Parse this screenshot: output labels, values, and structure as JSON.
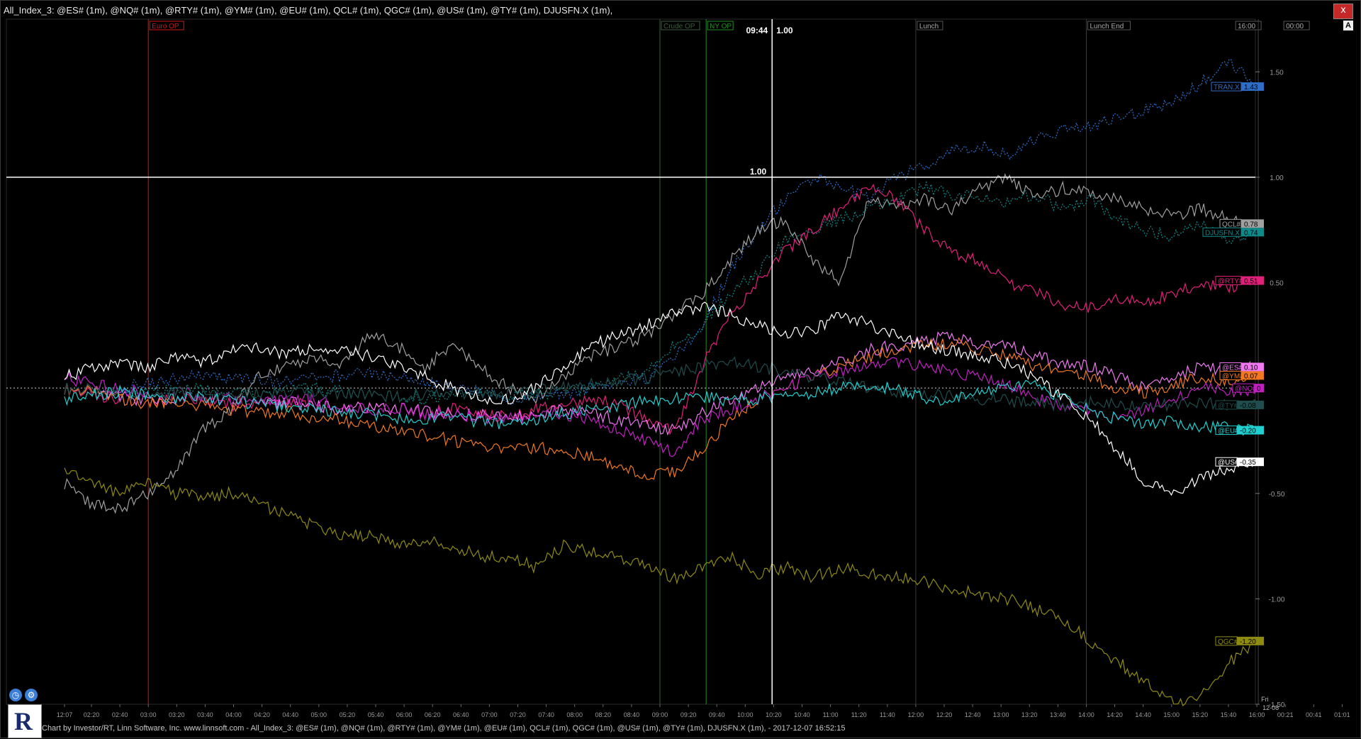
{
  "window": {
    "title": "All_Index_3: @ES# (1m), @NQ# (1m), @RTY# (1m), @YM# (1m), @EU# (1m), QCL# (1m), QGC# (1m), @US# (1m), @TY# (1m), DJUSFN.X (1m),",
    "close_label": "x",
    "auto_scale_label": "A"
  },
  "status_bar": {
    "text": "Chart by Investor/RT, Linn Software, Inc. www.linnsoft.com - All_Index_3: @ES# (1m), @NQ# (1m), @RTY# (1m), @YM# (1m), @EU# (1m), QCL# (1m), QGC# (1m), @US# (1m), @TY# (1m), DJUSFN.X (1m), - 2017-12-07 16:52:15"
  },
  "logo": {
    "letter": "R"
  },
  "icons": {
    "clock": "clock-icon",
    "settings": "gear-icon"
  },
  "colors": {
    "background": "#000000",
    "grid": "#1c1c1c",
    "crosshair": "#ffffff",
    "euro": "#d01818",
    "ny": "#1f8f1f",
    "crude": "#3c5c3c",
    "session": "#3a3a3a"
  },
  "crosshair": {
    "time": "09:44",
    "value": "1.00",
    "horizontal_label": "1.00"
  },
  "session_markers": [
    {
      "label": "Euro OP",
      "time": "03:00",
      "color": "#d01818"
    },
    {
      "label": "Crude OP",
      "time": "09:00",
      "color": "#3c5c3c"
    },
    {
      "label": "NY OP",
      "time": "09:30",
      "color": "#1f8f1f"
    },
    {
      "label": "Lunch",
      "time": "12:00",
      "color": "#3a3a3a"
    },
    {
      "label": "Lunch End",
      "time": "14:00",
      "color": "#3a3a3a"
    },
    {
      "label": "16:00",
      "time": "16:00",
      "color": "#3a3a3a"
    },
    {
      "label": "00:00",
      "time": "00:00",
      "color": "#3a3a3a"
    }
  ],
  "chart_data": {
    "type": "line",
    "title": "",
    "xlabel": "",
    "ylabel": "",
    "ylim": [
      -1.5,
      1.75
    ],
    "y_ticks": [
      "1.50",
      "1.00",
      "0.50",
      "-0.50",
      "-1.00",
      "-1.50"
    ],
    "x_ticks": [
      "12:07",
      "02:20",
      "02:40",
      "03:00",
      "03:20",
      "03:40",
      "04:00",
      "04:20",
      "04:40",
      "05:00",
      "05:20",
      "05:40",
      "06:00",
      "06:20",
      "06:40",
      "07:00",
      "07:20",
      "07:40",
      "08:00",
      "08:20",
      "08:40",
      "09:00",
      "09:20",
      "09:40",
      "10:00",
      "10:20",
      "10:40",
      "11:00",
      "11:20",
      "11:40",
      "12:00",
      "12:20",
      "12:40",
      "13:00",
      "13:20",
      "13:40",
      "14:00",
      "14:20",
      "14:40",
      "15:00",
      "15:20",
      "15:40",
      "16:00",
      "00:21",
      "00:41",
      "01:01"
    ],
    "x_day_label": "Fri",
    "x_day_date": "12-08",
    "grid": true,
    "zero_line": "dotted",
    "series": [
      {
        "name": "TRAN.X",
        "label": "1.43",
        "color": "#2e6ec8",
        "style": "dotted",
        "values": [
          0.05,
          0.02,
          0.0,
          0.02,
          0.04,
          0.06,
          0.05,
          0.04,
          0.03,
          0.05,
          0.06,
          0.08,
          0.05,
          0.03,
          0.0,
          -0.02,
          -0.05,
          -0.04,
          -0.03,
          0.0,
          0.02,
          0.05,
          0.15,
          0.3,
          0.55,
          0.75,
          0.9,
          1.0,
          0.95,
          0.9,
          1.0,
          1.05,
          1.12,
          1.15,
          1.1,
          1.18,
          1.22,
          1.25,
          1.28,
          1.32,
          1.35,
          1.45,
          1.55,
          1.43
        ]
      },
      {
        "name": "QCL#",
        "label": "0.78",
        "color": "#a0a0a0",
        "style": "solid",
        "values": [
          -0.45,
          -0.55,
          -0.58,
          -0.5,
          -0.4,
          -0.2,
          -0.1,
          0.05,
          0.1,
          0.15,
          0.1,
          0.25,
          0.2,
          0.1,
          0.2,
          0.1,
          0.0,
          -0.05,
          0.05,
          0.15,
          0.2,
          0.25,
          0.35,
          0.45,
          0.6,
          0.75,
          0.8,
          0.6,
          0.5,
          0.9,
          0.85,
          0.9,
          0.85,
          0.95,
          1.0,
          0.9,
          0.95,
          0.92,
          0.9,
          0.85,
          0.82,
          0.85,
          0.8,
          0.78
        ]
      },
      {
        "name": "DJUSFN.X",
        "label": "0.74",
        "color": "#0e8a8a",
        "style": "dotted",
        "values": [
          0.0,
          -0.02,
          -0.03,
          -0.02,
          -0.01,
          0.0,
          -0.02,
          -0.03,
          -0.01,
          0.0,
          -0.02,
          -0.03,
          -0.04,
          -0.05,
          -0.03,
          -0.02,
          -0.04,
          -0.03,
          -0.02,
          0.0,
          0.05,
          0.08,
          0.2,
          0.3,
          0.45,
          0.55,
          0.7,
          0.75,
          0.8,
          0.85,
          0.9,
          0.95,
          0.92,
          0.9,
          0.88,
          0.92,
          0.85,
          0.9,
          0.8,
          0.75,
          0.72,
          0.78,
          0.7,
          0.74
        ]
      },
      {
        "name": "@RTY#",
        "label": "0.51",
        "color": "#e0207a",
        "style": "solid",
        "values": [
          0.0,
          -0.03,
          -0.05,
          -0.08,
          -0.05,
          -0.06,
          -0.08,
          -0.07,
          -0.06,
          -0.08,
          -0.1,
          -0.09,
          -0.1,
          -0.12,
          -0.1,
          -0.12,
          -0.14,
          -0.1,
          -0.08,
          -0.05,
          -0.08,
          -0.15,
          -0.2,
          0.1,
          0.35,
          0.5,
          0.65,
          0.75,
          0.85,
          0.95,
          0.9,
          0.75,
          0.65,
          0.6,
          0.5,
          0.45,
          0.4,
          0.38,
          0.42,
          0.4,
          0.45,
          0.5,
          0.48,
          0.51
        ]
      },
      {
        "name": "@ES#",
        "label": "0.10",
        "color": "#f078f0",
        "style": "solid",
        "values": [
          0.0,
          -0.02,
          -0.04,
          -0.06,
          -0.05,
          -0.04,
          -0.06,
          -0.08,
          -0.07,
          -0.08,
          -0.1,
          -0.09,
          -0.1,
          -0.11,
          -0.12,
          -0.13,
          -0.14,
          -0.12,
          -0.1,
          -0.12,
          -0.15,
          -0.18,
          -0.2,
          -0.12,
          -0.05,
          0.0,
          0.05,
          0.08,
          0.12,
          0.18,
          0.2,
          0.22,
          0.25,
          0.2,
          0.22,
          0.15,
          0.12,
          0.1,
          0.05,
          0.0,
          0.05,
          0.1,
          0.08,
          0.1
        ]
      },
      {
        "name": "@YM#",
        "label": "0.07",
        "color": "#f07820",
        "style": "solid",
        "values": [
          0.0,
          -0.02,
          -0.05,
          -0.08,
          -0.07,
          -0.08,
          -0.1,
          -0.12,
          -0.11,
          -0.14,
          -0.15,
          -0.18,
          -0.2,
          -0.22,
          -0.25,
          -0.28,
          -0.3,
          -0.28,
          -0.3,
          -0.32,
          -0.38,
          -0.42,
          -0.4,
          -0.3,
          -0.15,
          -0.05,
          0.0,
          0.05,
          0.1,
          0.15,
          0.18,
          0.2,
          0.22,
          0.18,
          0.15,
          0.1,
          0.08,
          0.05,
          0.0,
          -0.02,
          0.02,
          0.05,
          0.03,
          0.07
        ]
      },
      {
        "name": "@NQ#",
        "label": "0",
        "color": "#c020c0",
        "style": "solid",
        "values": [
          0.05,
          0.02,
          0.0,
          -0.03,
          -0.02,
          -0.04,
          -0.05,
          -0.06,
          -0.05,
          -0.06,
          -0.08,
          -0.1,
          -0.1,
          -0.12,
          -0.12,
          -0.14,
          -0.15,
          -0.13,
          -0.12,
          -0.15,
          -0.2,
          -0.25,
          -0.3,
          -0.15,
          -0.1,
          -0.05,
          0.0,
          0.05,
          0.08,
          0.1,
          0.12,
          0.1,
          0.08,
          0.05,
          0.02,
          -0.05,
          -0.08,
          -0.1,
          -0.15,
          -0.1,
          -0.05,
          0.0,
          -0.02,
          0.0
        ]
      },
      {
        "name": "@TY#",
        "label": "-0.08",
        "color": "#1f4d4d",
        "style": "solid",
        "values": [
          0.0,
          -0.01,
          -0.02,
          -0.03,
          -0.02,
          -0.03,
          -0.04,
          -0.03,
          -0.02,
          -0.03,
          -0.02,
          -0.03,
          -0.04,
          -0.03,
          -0.02,
          -0.03,
          -0.02,
          -0.01,
          0.0,
          0.02,
          0.03,
          0.05,
          0.08,
          0.1,
          0.12,
          0.1,
          0.08,
          0.05,
          0.03,
          0.0,
          -0.02,
          -0.03,
          -0.04,
          -0.05,
          -0.06,
          -0.07,
          -0.08,
          -0.07,
          -0.08,
          -0.09,
          -0.08,
          -0.07,
          -0.08,
          -0.08
        ]
      },
      {
        "name": "@EU#",
        "label": "-0.20",
        "color": "#20d0d0",
        "style": "solid",
        "values": [
          -0.05,
          -0.03,
          -0.02,
          -0.03,
          -0.05,
          -0.04,
          -0.06,
          -0.08,
          -0.09,
          -0.1,
          -0.11,
          -0.12,
          -0.14,
          -0.15,
          -0.14,
          -0.16,
          -0.17,
          -0.15,
          -0.12,
          -0.1,
          -0.08,
          -0.06,
          -0.05,
          -0.04,
          -0.06,
          -0.05,
          -0.03,
          -0.02,
          0.0,
          0.01,
          0.0,
          -0.05,
          -0.06,
          -0.02,
          0.0,
          0.02,
          -0.05,
          -0.1,
          -0.15,
          -0.17,
          -0.16,
          -0.18,
          -0.19,
          -0.2
        ]
      },
      {
        "name": "@US#",
        "label": "-0.35",
        "color": "#ffffff",
        "style": "solid",
        "values": [
          0.05,
          0.1,
          0.12,
          0.1,
          0.15,
          0.12,
          0.18,
          0.2,
          0.15,
          0.2,
          0.18,
          0.15,
          0.1,
          0.05,
          0.0,
          -0.05,
          -0.05,
          0.0,
          0.1,
          0.2,
          0.25,
          0.3,
          0.35,
          0.38,
          0.35,
          0.3,
          0.25,
          0.28,
          0.35,
          0.3,
          0.25,
          0.2,
          0.18,
          0.15,
          0.12,
          0.05,
          -0.05,
          -0.15,
          -0.3,
          -0.45,
          -0.5,
          -0.42,
          -0.38,
          -0.35
        ]
      },
      {
        "name": "QGC#",
        "label": "-1.20",
        "color": "#8f8a10",
        "style": "solid",
        "values": [
          -0.4,
          -0.45,
          -0.5,
          -0.45,
          -0.5,
          -0.52,
          -0.5,
          -0.55,
          -0.6,
          -0.65,
          -0.7,
          -0.7,
          -0.75,
          -0.72,
          -0.75,
          -0.8,
          -0.8,
          -0.85,
          -0.75,
          -0.78,
          -0.8,
          -0.85,
          -0.9,
          -0.85,
          -0.8,
          -0.88,
          -0.85,
          -0.9,
          -0.85,
          -0.88,
          -0.9,
          -0.92,
          -0.95,
          -0.98,
          -1.0,
          -1.05,
          -1.1,
          -1.2,
          -1.3,
          -1.4,
          -1.5,
          -1.45,
          -1.3,
          -1.2
        ]
      }
    ]
  }
}
